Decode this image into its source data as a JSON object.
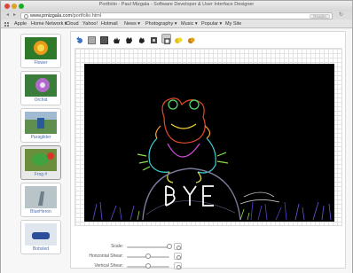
{
  "window": {
    "title": "Portfolio - Paul Mizgala - Software Developer & User Interface Designer"
  },
  "toolbar": {
    "url_domain": "www.pmizgala.com",
    "url_path": "/portfolio.html",
    "reader_label": "Reader"
  },
  "bookmarks": [
    {
      "label": "Apple"
    },
    {
      "label": "Home Network ▾"
    },
    {
      "label": "iCloud"
    },
    {
      "label": "Yahoo!"
    },
    {
      "label": "Hotmail"
    },
    {
      "label": "News ▾"
    },
    {
      "label": "Photography ▾"
    },
    {
      "label": "Music ▾"
    },
    {
      "label": "Popular ▾"
    },
    {
      "label": "My Site"
    }
  ],
  "thumbnails": [
    {
      "caption": "Flower",
      "selected": false
    },
    {
      "caption": "Orchid",
      "selected": false
    },
    {
      "caption": "Paraglider",
      "selected": false
    },
    {
      "caption": "Frog #",
      "selected": true
    },
    {
      "caption": "BlueHeron",
      "selected": false
    },
    {
      "caption": "Bobsled",
      "selected": false
    }
  ],
  "editor": {
    "tools": [
      {
        "icon": "undo-icon",
        "active": false
      },
      {
        "icon": "gray-square-icon",
        "active": false
      },
      {
        "icon": "dark-square-icon",
        "active": false
      },
      {
        "icon": "hand-grab-icon",
        "active": false
      },
      {
        "icon": "hand-pan-icon",
        "active": false
      },
      {
        "icon": "hand-move-icon",
        "active": false
      },
      {
        "icon": "edge-filter-icon",
        "active": true
      },
      {
        "icon": "photo-filter-icon",
        "active": false
      },
      {
        "icon": "yellow-tint-icon",
        "active": false
      },
      {
        "icon": "orange-tint-icon",
        "active": false
      }
    ],
    "controls": [
      {
        "label": "Scale:",
        "value": 1.0
      },
      {
        "label": "Horizontal Shear:",
        "value": 0.5
      },
      {
        "label": "Vertical Shear:",
        "value": 0.5
      }
    ]
  }
}
